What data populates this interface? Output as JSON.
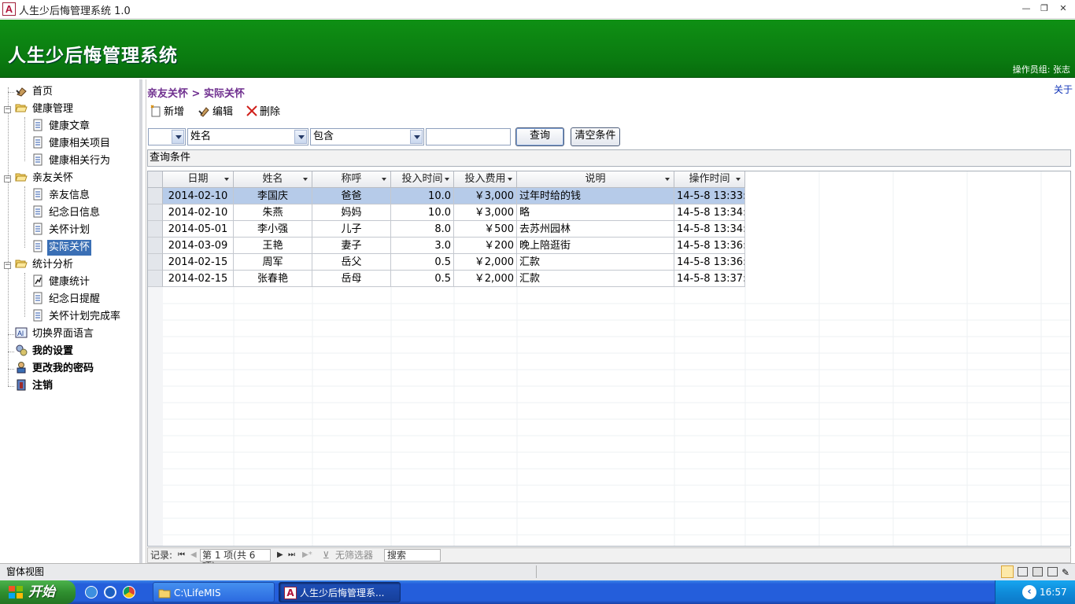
{
  "window": {
    "icon_letter": "A",
    "title": "人生少后悔管理系统 1.0",
    "minimize": "—",
    "restore": "❐",
    "close": "✕"
  },
  "header": {
    "app_title": "人生少后悔管理系统",
    "operator": "操作员组: 张志"
  },
  "sidebar": {
    "items": [
      {
        "label": "首页",
        "icon": "home-icon"
      },
      {
        "label": "健康管理",
        "icon": "folder-icon"
      },
      {
        "label": "健康文章",
        "icon": "document-icon"
      },
      {
        "label": "健康相关项目",
        "icon": "document-icon"
      },
      {
        "label": "健康相关行为",
        "icon": "document-icon"
      },
      {
        "label": "亲友关怀",
        "icon": "folder-icon"
      },
      {
        "label": "亲友信息",
        "icon": "document-icon"
      },
      {
        "label": "纪念日信息",
        "icon": "document-icon"
      },
      {
        "label": "关怀计划",
        "icon": "document-icon"
      },
      {
        "label": "实际关怀",
        "icon": "document-icon"
      },
      {
        "label": "统计分析",
        "icon": "folder-icon"
      },
      {
        "label": "健康统计",
        "icon": "chart-document-icon"
      },
      {
        "label": "纪念日提醒",
        "icon": "document-icon"
      },
      {
        "label": "关怀计划完成率",
        "icon": "document-icon"
      },
      {
        "label": "切换界面语言",
        "icon": "language-icon"
      },
      {
        "label": "我的设置",
        "icon": "settings-icon"
      },
      {
        "label": "更改我的密码",
        "icon": "password-icon"
      },
      {
        "label": "注销",
        "icon": "logout-icon"
      }
    ],
    "expanders": [
      "−",
      "−",
      "−"
    ]
  },
  "main": {
    "breadcrumb": "亲友关怀 > 实际关怀",
    "about": "关于",
    "toolbar": {
      "new": "新增",
      "edit": "编辑",
      "delete": "删除"
    },
    "filter": {
      "prefix": "",
      "field": "姓名",
      "operator": "包含",
      "value": "",
      "query_button": "查询",
      "clear_button": "清空条件"
    },
    "conditions_label": "查询条件",
    "table": {
      "columns": [
        "日期",
        "姓名",
        "称呼",
        "投入时间",
        "投入费用",
        "说明",
        "操作时间"
      ],
      "rows": [
        [
          "2014-02-10",
          "李国庆",
          "爸爸",
          "10.0",
          "￥3,000",
          "过年时给的钱",
          "14-5-8 13:33:"
        ],
        [
          "2014-02-10",
          "朱燕",
          "妈妈",
          "10.0",
          "￥3,000",
          "略",
          "14-5-8 13:34:"
        ],
        [
          "2014-05-01",
          "李小强",
          "儿子",
          "8.0",
          "￥500",
          "去苏州园林",
          "14-5-8 13:34:"
        ],
        [
          "2014-03-09",
          "王艳",
          "妻子",
          "3.0",
          "￥200",
          "晚上陪逛街",
          "14-5-8 13:36:"
        ],
        [
          "2014-02-15",
          "周军",
          "岳父",
          "0.5",
          "￥2,000",
          "汇款",
          "14-5-8 13:36:"
        ],
        [
          "2014-02-15",
          "张春艳",
          "岳母",
          "0.5",
          "￥2,000",
          "汇款",
          "14-5-8 13:37:"
        ]
      ]
    },
    "record_nav": {
      "label": "记录:",
      "position": "第 1 项(共 6 项)",
      "no_filter": "无筛选器",
      "search": "搜索"
    }
  },
  "statusbar": {
    "text": "窗体视图"
  },
  "taskbar": {
    "start": "开始",
    "tasks": [
      "C:\\LifeMIS",
      "人生少后悔管理系..."
    ],
    "clock": "16:57"
  },
  "colors": {
    "banner_green": "#0a7a10",
    "breadcrumb_purple": "#6f2f8f",
    "selection_blue": "#3a6fb5",
    "row_highlight": "#b6cbe9",
    "taskbar_blue": "#245edb"
  }
}
